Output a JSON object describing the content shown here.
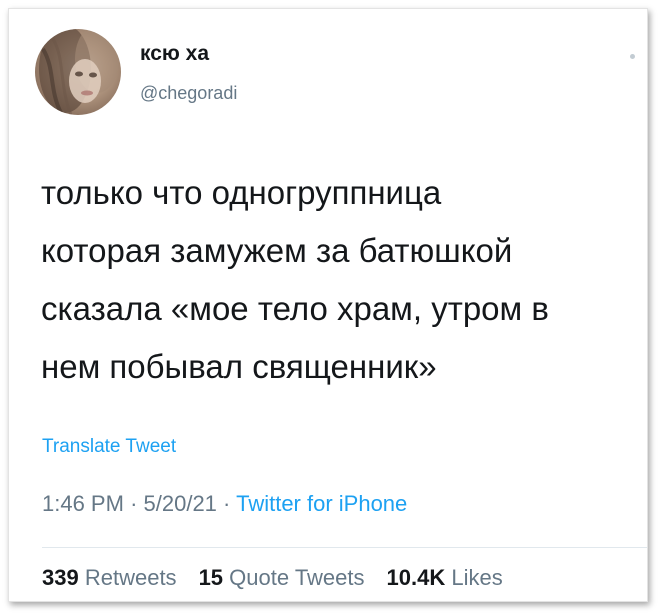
{
  "tweet": {
    "author": {
      "name": "ксю ха",
      "handle": "@chegoradi"
    },
    "text": "только что одногруппница\nкоторая замужем за батюшкой\nсказала «мое тело храм, утром в\nнем побывал священник»",
    "translate_label": "Translate Tweet",
    "time": "1:46 PM",
    "separator": "·",
    "date": "5/20/21",
    "source": "Twitter for iPhone",
    "stats": {
      "retweets_count": "339",
      "retweets_label": "Retweets",
      "quotes_count": "15",
      "quotes_label": "Quote Tweets",
      "likes_count": "10.4K",
      "likes_label": "Likes"
    }
  },
  "colors": {
    "link": "#1da1f2",
    "secondary_text": "#657786",
    "primary_text": "#14171a"
  },
  "icons": {
    "more": "more-options-icon"
  }
}
